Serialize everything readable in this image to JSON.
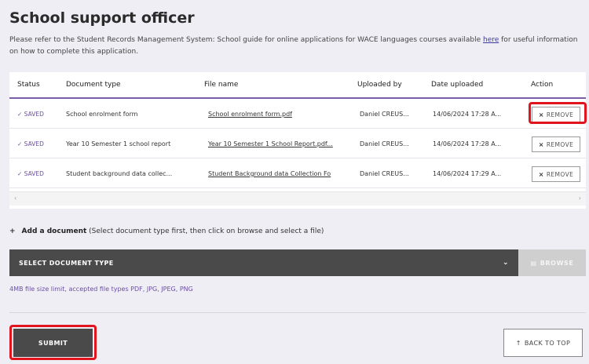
{
  "page": {
    "title": "School support officer",
    "intro_text": "Please refer to the Student Records Management System: School guide for online applications for WACE languages courses available ",
    "intro_link": "here",
    "intro_text_after": " for useful information on how to complete this application."
  },
  "table": {
    "headers": {
      "status": "Status",
      "doc_type": "Document type",
      "file_name": "File name",
      "uploaded_by": "Uploaded by",
      "date_uploaded": "Date uploaded",
      "action": "Action"
    },
    "rows": [
      {
        "status": "✓ SAVED",
        "doc_type": "School enrolment form",
        "file_name": "School enrolment form.pdf",
        "uploaded_by": "Daniel CREUS...",
        "date_uploaded": "14/06/2024 17:28 A...",
        "action": "REMOVE"
      },
      {
        "status": "✓ SAVED",
        "doc_type": "Year 10 Semester 1 school report",
        "file_name": "Year 10 Semester 1 School Report.pdf...",
        "uploaded_by": "Daniel CREUS...",
        "date_uploaded": "14/06/2024 17:28 A...",
        "action": "REMOVE"
      },
      {
        "status": "✓ SAVED",
        "doc_type": "Student background data collec...",
        "file_name": "Student Background data Collection Fo",
        "uploaded_by": "Daniel CREUS...",
        "date_uploaded": "14/06/2024 17:29 A...",
        "action": "REMOVE"
      }
    ],
    "remove_icon": "×"
  },
  "add_document": {
    "plus": "+",
    "label": "Add a document",
    "hint": " (Select document type first, then click on browse and select a file)"
  },
  "select": {
    "value": "SELECT DOCUMENT TYPE",
    "chevron": "⌄"
  },
  "browse": {
    "icon": "▤",
    "label": "BROWSE"
  },
  "limit_text": "4MB file size limit, accepted file types PDF, JPG, JPEG, PNG",
  "footer": {
    "submit_label": "SUBMIT",
    "back_icon": "↑",
    "back_label": "BACK TO TOP"
  },
  "scroll": {
    "left": "‹",
    "right": "›"
  },
  "colors": {
    "accent": "#6b4fa0",
    "highlight": "#e0141c",
    "dark_button": "#4a4a4a"
  }
}
